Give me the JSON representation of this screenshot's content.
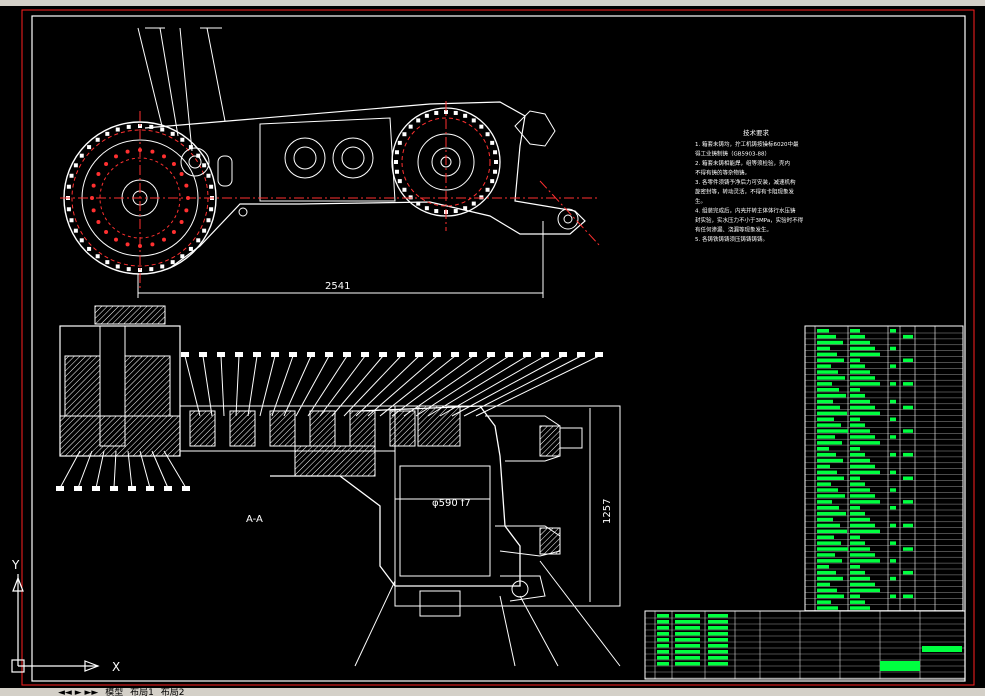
{
  "colors": {
    "background": "#000000",
    "line": "#ffffff",
    "center_line": "#ff3030",
    "frame": "#ff2020",
    "table_fill": "#00ff40",
    "hatch": "#ffffff",
    "ui_chrome": "#d4d0c8"
  },
  "drawing": {
    "dimension_length": "2541",
    "dimension_diameter": "φ590 f7",
    "dimension_height": "1257",
    "section_label": "A-A",
    "tech_requirements": {
      "title": "技术要求",
      "lines": [
        "1. 箱套未铸均，拧工机铸按操标6020中最",
        "得工业铸制铸（GB5903-88）",
        "2. 箱套未铸相能焊，组等须检验，壳内",
        "不得有铸的等杂物铸。",
        "3. 各零件须铸予净后力可安装，减速机构",
        "旋密封等，转动灵活，不得有卡阻现象发",
        "生。",
        "4. 组装完成后，内壳并转主体体行水压铸",
        "封实验，实水压力不小于3MPa，实验时不得",
        "有任何渗漏、浇漏等现象发生。",
        "5. 各铸铁铸铸须压铸铸铸铸。"
      ]
    }
  },
  "ucs": {
    "x_label": "X",
    "y_label": "Y"
  },
  "layout_tabs": {
    "nav": "◄◄ ► ►►",
    "items": [
      "模型",
      "布局1",
      "布局2"
    ]
  }
}
